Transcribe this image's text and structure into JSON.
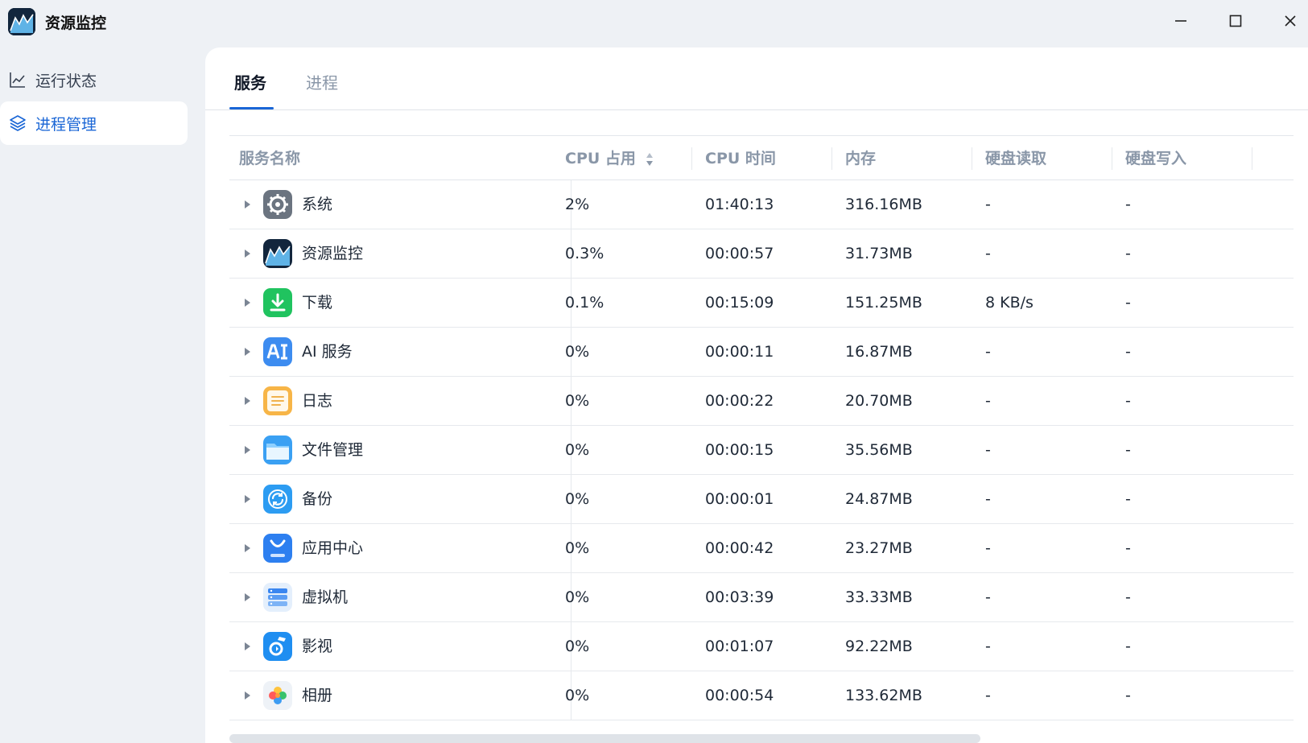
{
  "window": {
    "title": "资源监控"
  },
  "sidebar": {
    "items": [
      {
        "label": "运行状态",
        "icon": "line-chart-icon",
        "active": false
      },
      {
        "label": "进程管理",
        "icon": "layers-icon",
        "active": true
      }
    ]
  },
  "tabs": [
    {
      "label": "服务",
      "active": true
    },
    {
      "label": "进程",
      "active": false
    }
  ],
  "table": {
    "columns": [
      "服务名称",
      "CPU 占用",
      "CPU 时间",
      "内存",
      "硬盘读取",
      "硬盘写入"
    ],
    "rows": [
      {
        "icon": "system-gear-icon",
        "name": "系统",
        "cpu": "2%",
        "cpu_time": "01:40:13",
        "memory": "316.16MB",
        "disk_read": "-",
        "disk_write": "-"
      },
      {
        "icon": "resource-monitor-icon",
        "name": "资源监控",
        "cpu": "0.3%",
        "cpu_time": "00:00:57",
        "memory": "31.73MB",
        "disk_read": "-",
        "disk_write": "-"
      },
      {
        "icon": "download-icon",
        "name": "下载",
        "cpu": "0.1%",
        "cpu_time": "00:15:09",
        "memory": "151.25MB",
        "disk_read": "8 KB/s",
        "disk_write": "-"
      },
      {
        "icon": "ai-service-icon",
        "name": "AI 服务",
        "cpu": "0%",
        "cpu_time": "00:00:11",
        "memory": "16.87MB",
        "disk_read": "-",
        "disk_write": "-"
      },
      {
        "icon": "log-icon",
        "name": "日志",
        "cpu": "0%",
        "cpu_time": "00:00:22",
        "memory": "20.70MB",
        "disk_read": "-",
        "disk_write": "-"
      },
      {
        "icon": "file-manager-icon",
        "name": "文件管理",
        "cpu": "0%",
        "cpu_time": "00:00:15",
        "memory": "35.56MB",
        "disk_read": "-",
        "disk_write": "-"
      },
      {
        "icon": "backup-icon",
        "name": "备份",
        "cpu": "0%",
        "cpu_time": "00:00:01",
        "memory": "24.87MB",
        "disk_read": "-",
        "disk_write": "-"
      },
      {
        "icon": "app-store-icon",
        "name": "应用中心",
        "cpu": "0%",
        "cpu_time": "00:00:42",
        "memory": "23.27MB",
        "disk_read": "-",
        "disk_write": "-"
      },
      {
        "icon": "virtual-machine-icon",
        "name": "虚拟机",
        "cpu": "0%",
        "cpu_time": "00:03:39",
        "memory": "33.33MB",
        "disk_read": "-",
        "disk_write": "-"
      },
      {
        "icon": "video-icon",
        "name": "影视",
        "cpu": "0%",
        "cpu_time": "00:01:07",
        "memory": "92.22MB",
        "disk_read": "-",
        "disk_write": "-"
      },
      {
        "icon": "photos-icon",
        "name": "相册",
        "cpu": "0%",
        "cpu_time": "00:00:54",
        "memory": "133.62MB",
        "disk_read": "-",
        "disk_write": "-"
      }
    ]
  },
  "colors": {
    "accent": "#1a66d6",
    "header_text": "#8a97a8",
    "sidebar_bg": "#eef1f5"
  }
}
